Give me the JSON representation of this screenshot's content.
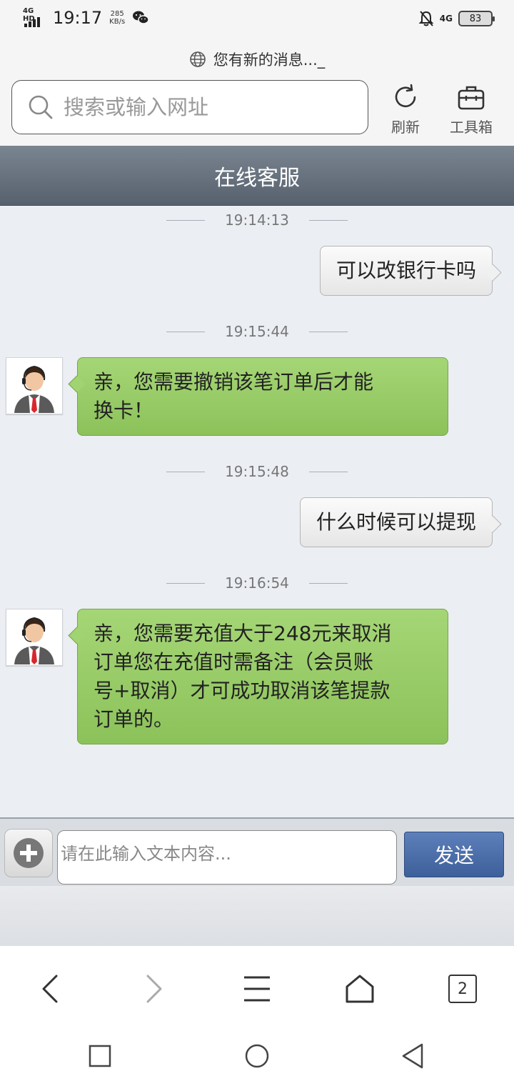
{
  "status_bar": {
    "network": "4G HD",
    "time": "19:17",
    "speed_value": "285",
    "speed_unit": "KB/s",
    "net_right": "4G",
    "battery": "83"
  },
  "browser": {
    "page_title": "您有新的消息..._",
    "search_placeholder": "搜索或输入网址",
    "refresh_label": "刷新",
    "toolbox_label": "工具箱"
  },
  "chat": {
    "title": "在线客服",
    "messages": [
      {
        "time": "19:14:13",
        "direction": "out",
        "text": "可以改银行卡吗"
      },
      {
        "time": "19:15:44",
        "direction": "in",
        "lines": [
          "亲，您需要撤销该笔订单后才能",
          "换卡！"
        ]
      },
      {
        "time": "19:15:48",
        "direction": "out",
        "text": "什么时候可以提现"
      },
      {
        "time": "19:16:54",
        "direction": "in",
        "lines": [
          "亲，您需要充值大于248元来取消",
          "订单您在充值时需备注（会员账",
          "号+取消）才可成功取消该笔提款",
          "订单的。"
        ]
      }
    ]
  },
  "composer": {
    "placeholder": "请在此输入文本内容...",
    "send_label": "发送"
  },
  "browser_nav": {
    "tab_count": "2"
  },
  "colors": {
    "titlebar": "#56616d",
    "incoming_bubble": "#9ccd6c",
    "outgoing_bubble": "#eeeeee",
    "send_button": "#4a6ba6",
    "chat_background": "#ebeef3"
  }
}
